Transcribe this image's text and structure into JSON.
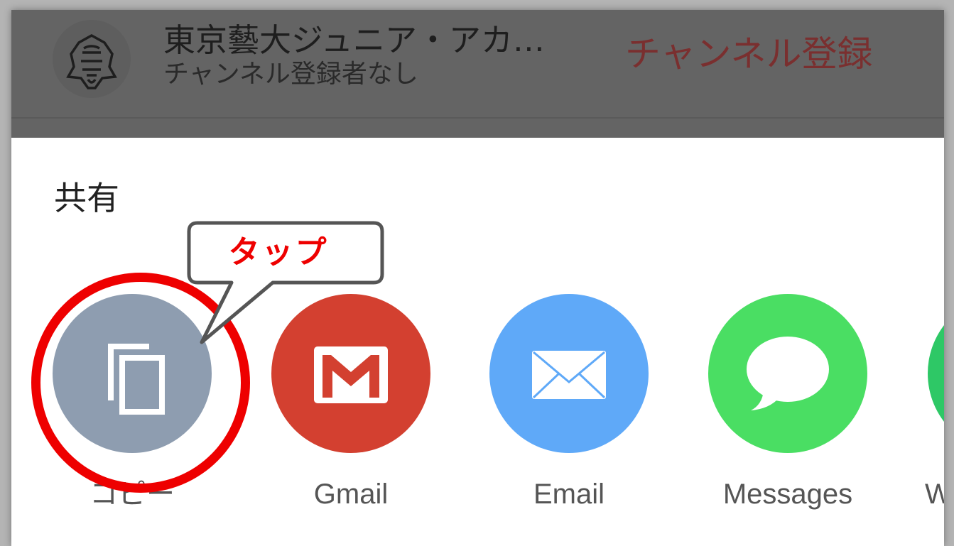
{
  "header": {
    "channel_name": "東京藝大ジュニア・アカ…",
    "subscriber_text": "チャンネル登録者なし",
    "subscribe_label": "チャンネル登録"
  },
  "share_sheet": {
    "title": "共有",
    "targets": [
      {
        "label": "コピー",
        "icon": "copy-icon",
        "color": "#8e9db0"
      },
      {
        "label": "Gmail",
        "icon": "gmail-icon",
        "color": "#d34030"
      },
      {
        "label": "Email",
        "icon": "mail-icon",
        "color": "#5fa9f8"
      },
      {
        "label": "Messages",
        "icon": "message-icon",
        "color": "#4ade63"
      },
      {
        "label": "W",
        "icon": "partial-app-icon",
        "color": "#2ec866"
      }
    ]
  },
  "annotation": {
    "callout_text": "タップ",
    "highlight_color": "#ee0000"
  }
}
